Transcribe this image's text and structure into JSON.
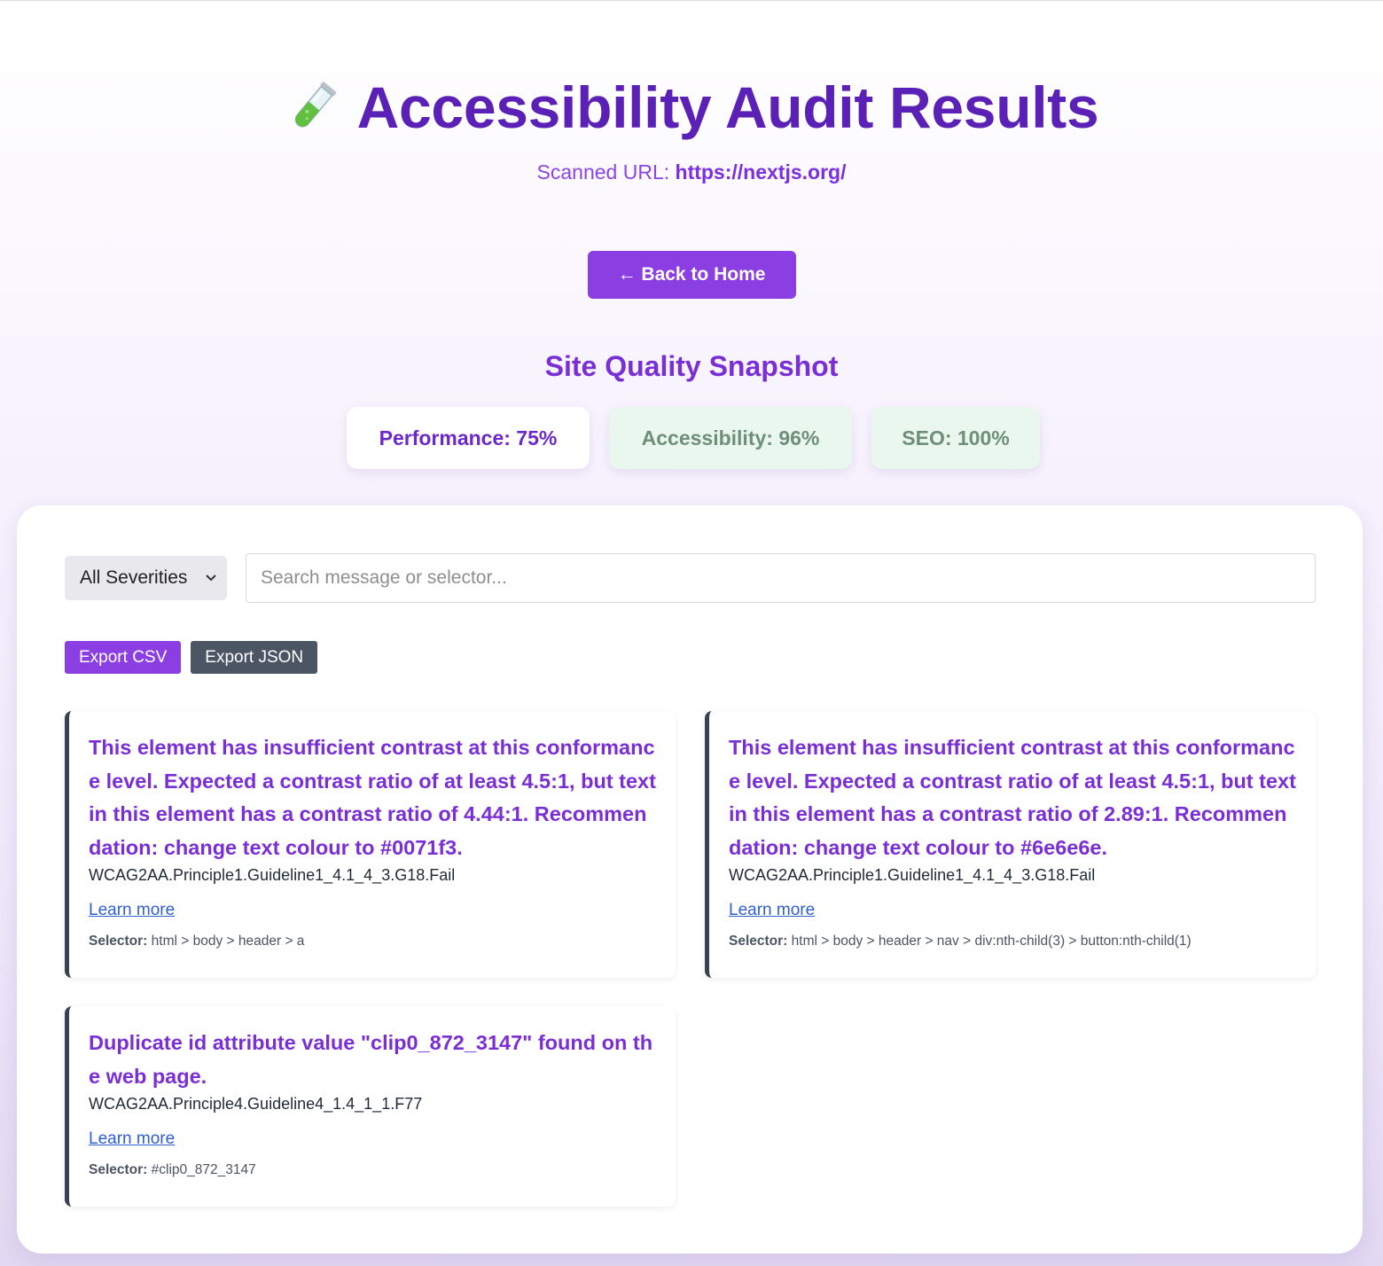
{
  "header": {
    "title": "Accessibility Audit Results",
    "scanned_label": "Scanned URL:",
    "scanned_url": "https://nextjs.org/"
  },
  "back_button": "← Back to Home",
  "snapshot": {
    "title": "Site Quality Snapshot",
    "scores": [
      {
        "label": "Performance: 75%",
        "status_color": "#ffffff"
      },
      {
        "label": "Accessibility: 96%",
        "status_color": "#e9f7ee"
      },
      {
        "label": "SEO: 100%",
        "status_color": "#e9f7ee"
      }
    ]
  },
  "filters": {
    "severity_selected": "All Severities",
    "search_placeholder": "Search message or selector..."
  },
  "exports": {
    "csv_label": "Export CSV",
    "json_label": "Export JSON"
  },
  "issues": [
    {
      "message": "This element has insufficient contrast at this conformance level. Expected a contrast ratio of at least 4.5:1, but text in this element has a contrast ratio of 4.44:1. Recommendation:  change text colour to #0071f3.",
      "code": "WCAG2AA.Principle1.Guideline1_4.1_4_3.G18.Fail",
      "learn_more": "Learn more",
      "selector_label": "Selector:",
      "selector": "html > body > header > a"
    },
    {
      "message": "This element has insufficient contrast at this conformance level. Expected a contrast ratio of at least 4.5:1, but text in this element has a contrast ratio of 2.89:1. Recommendation:  change text colour to #6e6e6e.",
      "code": "WCAG2AA.Principle1.Guideline1_4.1_4_3.G18.Fail",
      "learn_more": "Learn more",
      "selector_label": "Selector:",
      "selector": "html > body > header > nav > div:nth-child(3) > button:nth-child(1)"
    },
    {
      "message": "Duplicate id attribute value \"clip0_872_3147\" found on the web page.",
      "code": "WCAG2AA.Principle4.Guideline4_1.4_1_1.F77",
      "learn_more": "Learn more",
      "selector_label": "Selector:",
      "selector": "#clip0_872_3147"
    }
  ],
  "colors": {
    "brand_purple": "#8b3fe3",
    "title_purple": "#5b21b6",
    "good_score_bg": "#e9f7ee",
    "link_blue": "#2f5fd0"
  }
}
